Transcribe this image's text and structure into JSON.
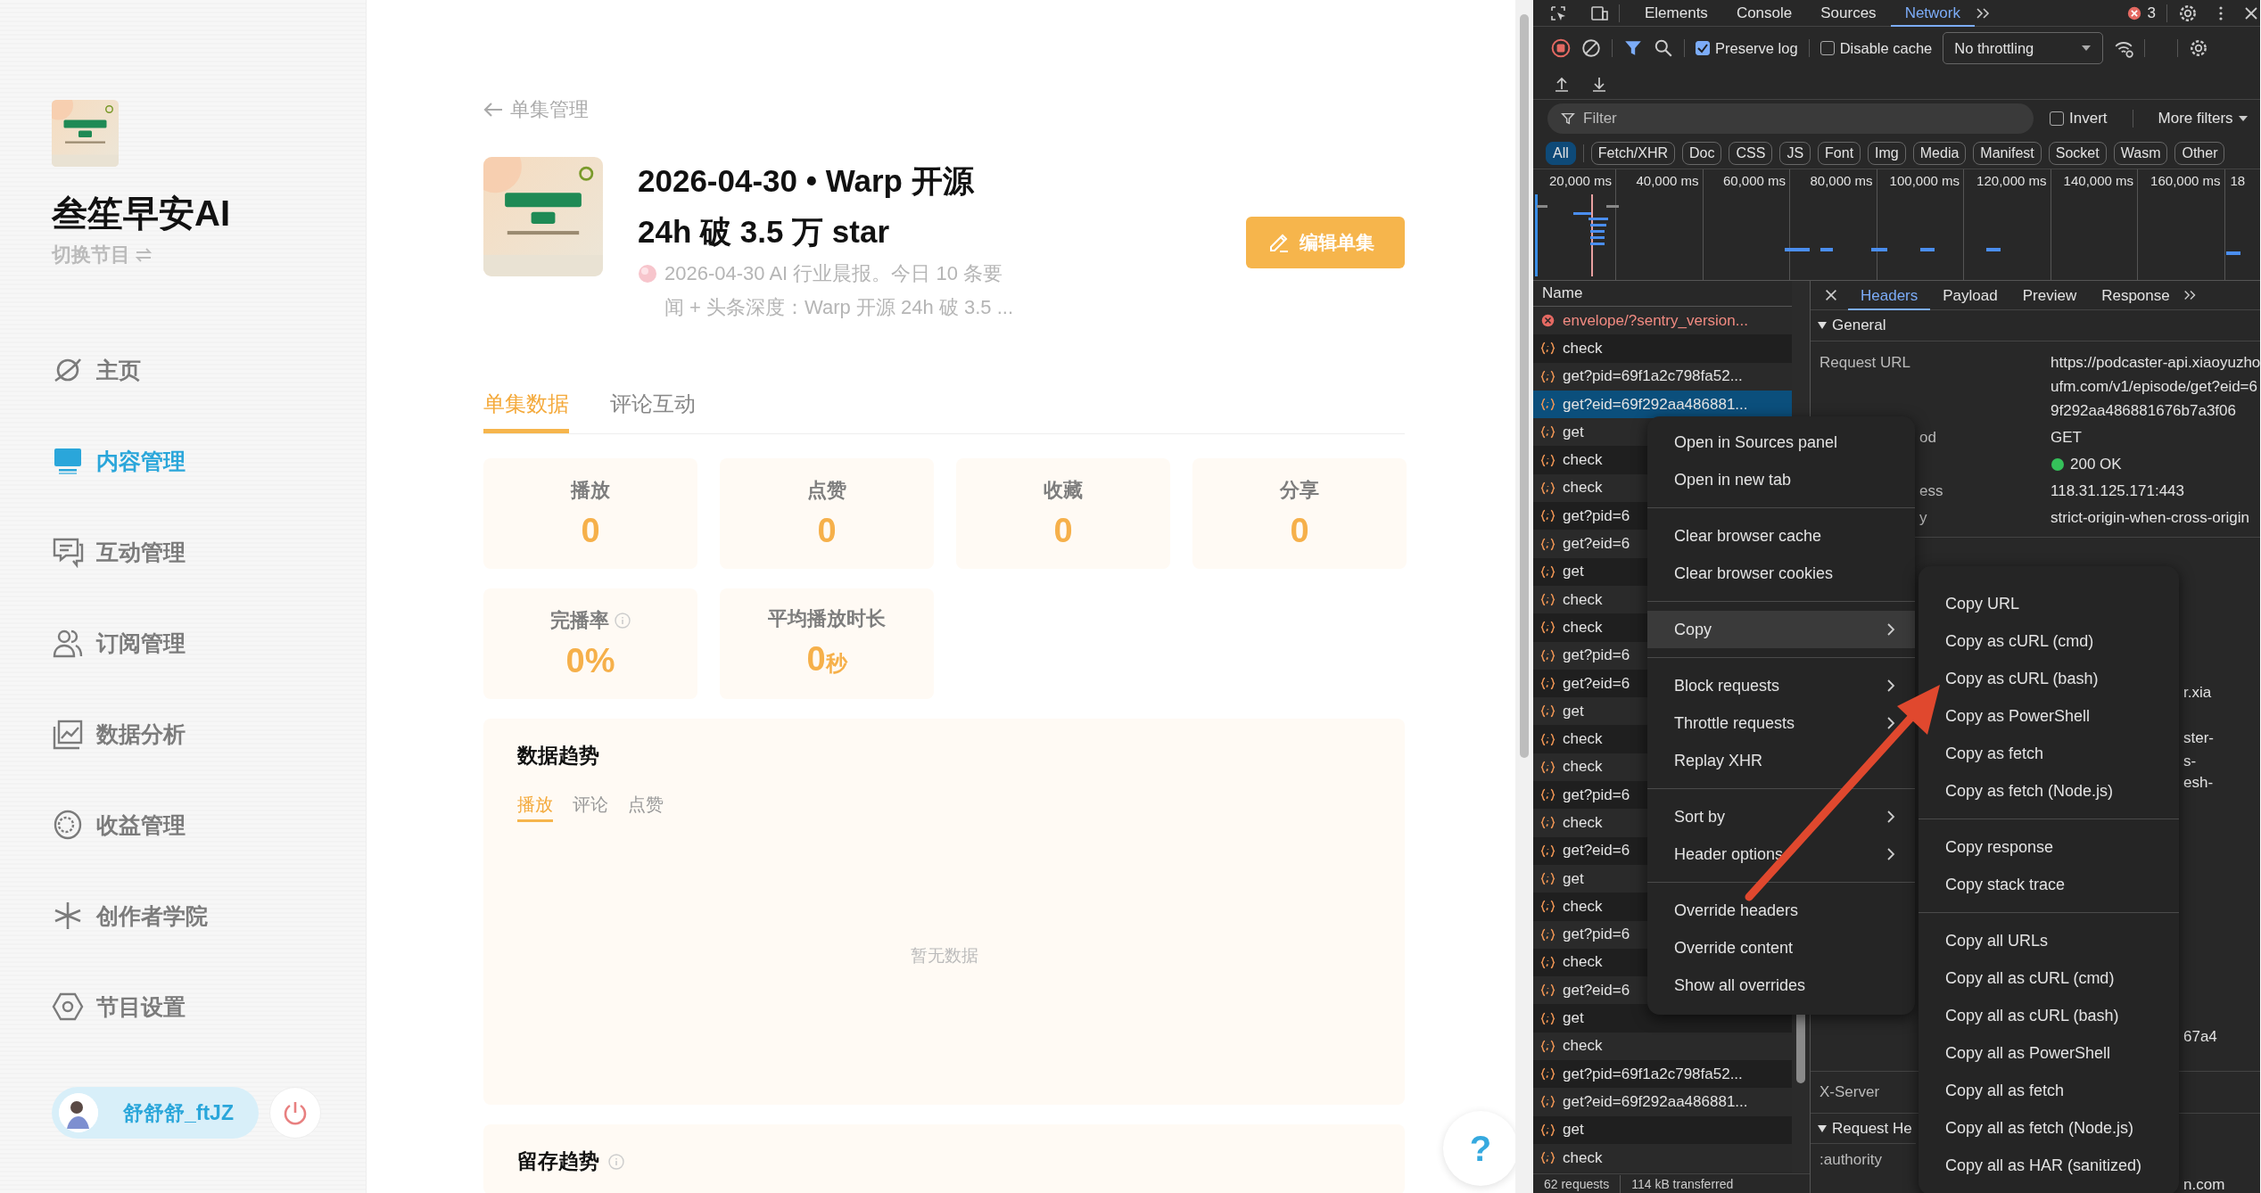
{
  "sidebar": {
    "show_title": "叁笙早安AI",
    "switch_label": "切换节目",
    "nav": [
      {
        "label": "主页",
        "selected": false
      },
      {
        "label": "内容管理",
        "selected": true
      },
      {
        "label": "互动管理",
        "selected": false
      },
      {
        "label": "订阅管理",
        "selected": false
      },
      {
        "label": "数据分析",
        "selected": false
      },
      {
        "label": "收益管理",
        "selected": false
      },
      {
        "label": "创作者学院",
        "selected": false
      },
      {
        "label": "节目设置",
        "selected": false
      }
    ],
    "user": {
      "name": "舒舒舒_ftJZ"
    }
  },
  "main": {
    "back_label": "单集管理",
    "episode": {
      "title": "2026-04-30 • Warp 开源 24h 破 3.5 万 star",
      "description": "2026-04-30 AI 行业晨报。今日 10 条要闻 + 头条深度：Warp 开源 24h 破 3.5 ..."
    },
    "edit_button": "编辑单集",
    "tabs": [
      {
        "label": "单集数据",
        "selected": true
      },
      {
        "label": "评论互动",
        "selected": false
      }
    ],
    "stats": [
      {
        "label": "播放",
        "value": "0",
        "info": false
      },
      {
        "label": "点赞",
        "value": "0",
        "info": false
      },
      {
        "label": "收藏",
        "value": "0",
        "info": false
      },
      {
        "label": "分享",
        "value": "0",
        "info": false
      },
      {
        "label": "完播率",
        "value": "0%",
        "info": true
      },
      {
        "label": "平均播放时长",
        "value": "0",
        "unit": "秒",
        "info": false
      }
    ],
    "trend": {
      "title": "数据趋势",
      "tabs": [
        {
          "label": "播放",
          "selected": true
        },
        {
          "label": "评论",
          "selected": false
        },
        {
          "label": "点赞",
          "selected": false
        }
      ],
      "empty_text": "暂无数据"
    },
    "retention": {
      "title": "留存趋势",
      "info": true
    },
    "help": "?"
  },
  "devtools": {
    "panel_tabs": [
      {
        "label": "Elements",
        "selected": false
      },
      {
        "label": "Console",
        "selected": false
      },
      {
        "label": "Sources",
        "selected": false
      },
      {
        "label": "Network",
        "selected": true
      }
    ],
    "error_count": "3",
    "toolbar": {
      "preserve_log": {
        "label": "Preserve log",
        "checked": true
      },
      "disable_cache": {
        "label": "Disable cache",
        "checked": false
      },
      "throttling": "No throttling"
    },
    "filter": {
      "placeholder": "Filter",
      "invert": {
        "label": "Invert",
        "checked": false
      },
      "more_filters": "More filters"
    },
    "type_filters": [
      {
        "label": "All",
        "selected": true
      },
      {
        "label": "Fetch/XHR",
        "selected": false
      },
      {
        "label": "Doc",
        "selected": false
      },
      {
        "label": "CSS",
        "selected": false
      },
      {
        "label": "JS",
        "selected": false
      },
      {
        "label": "Font",
        "selected": false
      },
      {
        "label": "Img",
        "selected": false
      },
      {
        "label": "Media",
        "selected": false
      },
      {
        "label": "Manifest",
        "selected": false
      },
      {
        "label": "Socket",
        "selected": false
      },
      {
        "label": "Wasm",
        "selected": false
      },
      {
        "label": "Other",
        "selected": false
      }
    ],
    "timeline_ticks": [
      "20,000 ms",
      "40,000 ms",
      "60,000 ms",
      "80,000 ms",
      "100,000 ms",
      "120,000 ms",
      "140,000 ms",
      "160,000 ms",
      "18"
    ],
    "requests": {
      "column": "Name",
      "rows": [
        {
          "name": "envelope/?sentry_version...",
          "kind": "error",
          "selected": false
        },
        {
          "name": "check",
          "kind": "fetch",
          "selected": false
        },
        {
          "name": "get?pid=69f1a2c798fa52...",
          "kind": "fetch",
          "selected": false
        },
        {
          "name": "get?eid=69f292aa486881...",
          "kind": "fetch",
          "selected": true
        },
        {
          "name": "get",
          "kind": "fetch",
          "selected": false
        },
        {
          "name": "check",
          "kind": "fetch",
          "selected": false
        },
        {
          "name": "check",
          "kind": "fetch",
          "selected": false
        },
        {
          "name": "get?pid=6",
          "kind": "fetch",
          "selected": false
        },
        {
          "name": "get?eid=6",
          "kind": "fetch",
          "selected": false
        },
        {
          "name": "get",
          "kind": "fetch",
          "selected": false
        },
        {
          "name": "check",
          "kind": "fetch",
          "selected": false
        },
        {
          "name": "check",
          "kind": "fetch",
          "selected": false
        },
        {
          "name": "get?pid=6",
          "kind": "fetch",
          "selected": false
        },
        {
          "name": "get?eid=6",
          "kind": "fetch",
          "selected": false
        },
        {
          "name": "get",
          "kind": "fetch",
          "selected": false
        },
        {
          "name": "check",
          "kind": "fetch",
          "selected": false
        },
        {
          "name": "check",
          "kind": "fetch",
          "selected": false
        },
        {
          "name": "get?pid=6",
          "kind": "fetch",
          "selected": false
        },
        {
          "name": "check",
          "kind": "fetch",
          "selected": false
        },
        {
          "name": "get?eid=6",
          "kind": "fetch",
          "selected": false
        },
        {
          "name": "get",
          "kind": "fetch",
          "selected": false
        },
        {
          "name": "check",
          "kind": "fetch",
          "selected": false
        },
        {
          "name": "get?pid=6",
          "kind": "fetch",
          "selected": false
        },
        {
          "name": "check",
          "kind": "fetch",
          "selected": false
        },
        {
          "name": "get?eid=6",
          "kind": "fetch",
          "selected": false
        },
        {
          "name": "get",
          "kind": "fetch",
          "selected": false
        },
        {
          "name": "check",
          "kind": "fetch",
          "selected": false
        },
        {
          "name": "get?pid=69f1a2c798fa52...",
          "kind": "fetch",
          "selected": false
        },
        {
          "name": "get?eid=69f292aa486881...",
          "kind": "fetch",
          "selected": false
        },
        {
          "name": "get",
          "kind": "fetch",
          "selected": false
        },
        {
          "name": "check",
          "kind": "fetch",
          "selected": false
        }
      ]
    },
    "detail": {
      "tabs": [
        {
          "label": "Headers",
          "selected": true
        },
        {
          "label": "Payload",
          "selected": false
        },
        {
          "label": "Preview",
          "selected": false
        },
        {
          "label": "Response",
          "selected": false
        }
      ],
      "general_title": "General",
      "general": [
        {
          "label": "Request URL",
          "value": "https://podcaster-api.xiaoyuzhoufm.com/v1/episode/get?eid=69f292aa486881676b7a3f06",
          "kind": "plain"
        },
        {
          "label": "od",
          "value": "GET",
          "kind": "clipped"
        },
        {
          "value": "200 OK",
          "kind": "status"
        },
        {
          "label": "ess",
          "value": "118.31.125.171:443",
          "kind": "clipped"
        },
        {
          "label": "y",
          "value": "strict-origin-when-cross-origin",
          "kind": "clipped"
        }
      ],
      "fragments": [
        "r.xia",
        "ster-",
        "s-",
        "esh-",
        "67a4",
        "n.com"
      ],
      "x_server_label": "X-Server",
      "request_headers_title": "Request He",
      "authority_label": ":authority"
    },
    "status": {
      "requests": "62 requests",
      "transferred": "114 kB transferred"
    },
    "context_menu": {
      "groups": [
        {
          "items": [
            {
              "label": "Open in Sources panel",
              "has_submenu": false,
              "highlighted": false
            },
            {
              "label": "Open in new tab",
              "has_submenu": false,
              "highlighted": false
            }
          ]
        },
        {
          "items": [
            {
              "label": "Clear browser cache",
              "has_submenu": false,
              "highlighted": false
            },
            {
              "label": "Clear browser cookies",
              "has_submenu": false,
              "highlighted": false
            }
          ]
        },
        {
          "items": [
            {
              "label": "Copy",
              "has_submenu": true,
              "highlighted": true
            }
          ]
        },
        {
          "items": [
            {
              "label": "Block requests",
              "has_submenu": true,
              "highlighted": false
            },
            {
              "label": "Throttle requests",
              "has_submenu": true,
              "highlighted": false
            },
            {
              "label": "Replay XHR",
              "has_submenu": false,
              "highlighted": false
            }
          ]
        },
        {
          "items": [
            {
              "label": "Sort by",
              "has_submenu": true,
              "highlighted": false
            },
            {
              "label": "Header options",
              "has_submenu": true,
              "highlighted": false
            }
          ]
        },
        {
          "items": [
            {
              "label": "Override headers",
              "has_submenu": false,
              "highlighted": false
            },
            {
              "label": "Override content",
              "has_submenu": false,
              "highlighted": false
            },
            {
              "label": "Show all overrides",
              "has_submenu": false,
              "highlighted": false
            }
          ]
        }
      ]
    },
    "copy_submenu": {
      "groups": [
        {
          "items": [
            "Copy URL",
            "Copy as cURL (cmd)",
            "Copy as cURL (bash)",
            "Copy as PowerShell",
            "Copy as fetch",
            "Copy as fetch (Node.js)"
          ]
        },
        {
          "items": [
            "Copy response",
            "Copy stack trace"
          ]
        },
        {
          "items": [
            "Copy all URLs",
            "Copy all as cURL (cmd)",
            "Copy all as cURL (bash)",
            "Copy all as PowerShell",
            "Copy all as fetch",
            "Copy all as fetch (Node.js)",
            "Copy all as HAR (sanitized)"
          ]
        }
      ]
    }
  }
}
